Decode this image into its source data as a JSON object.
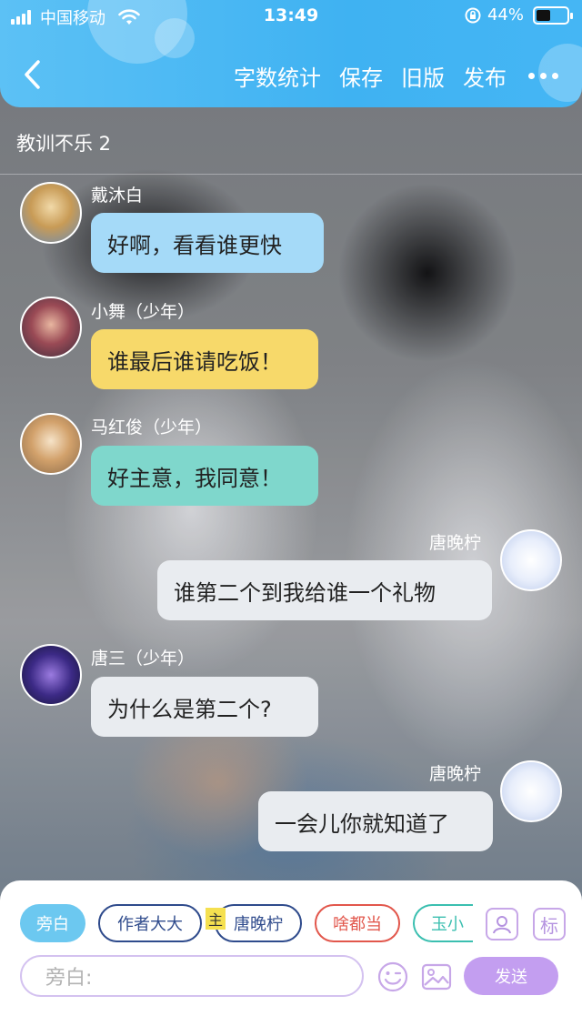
{
  "status_bar": {
    "carrier": "中国移动",
    "time": "13:49",
    "battery_percent": "44%"
  },
  "nav": {
    "actions": [
      "字数统计",
      "保存",
      "旧版",
      "发布"
    ]
  },
  "chat_title": "教训不乐 2",
  "messages": [
    {
      "speaker": "戴沐白",
      "text": "好啊，看看谁更快",
      "side": "left",
      "bubble_color": "#a5daf8"
    },
    {
      "speaker": "小舞（少年）",
      "text": "谁最后谁请吃饭！",
      "side": "left",
      "bubble_color": "#f7d96a"
    },
    {
      "speaker": "马红俊（少年）",
      "text": "好主意，我同意！",
      "side": "left",
      "bubble_color": "#7fd7cc"
    },
    {
      "speaker": "唐晚柠",
      "text": "谁第二个到我给谁一个礼物",
      "side": "right",
      "bubble_color": "#e9ecf0"
    },
    {
      "speaker": "唐三（少年）",
      "text": "为什么是第二个?",
      "side": "left",
      "bubble_color": "#e9ecf0"
    },
    {
      "speaker": "唐晚柠",
      "text": "一会儿你就知道了",
      "side": "right",
      "bubble_color": "#e9ecf0"
    }
  ],
  "chips": [
    {
      "label": "旁白",
      "style": "filled",
      "color": "#6cc8f0"
    },
    {
      "label": "作者大大",
      "style": "outline",
      "color": "#2f4b8c"
    },
    {
      "label": "唐晚柠",
      "style": "outline",
      "color": "#2f4b8c",
      "tag": "主"
    },
    {
      "label": "啥都当",
      "style": "outline",
      "color": "#e2574c"
    },
    {
      "label": "玉小",
      "style": "outline",
      "color": "#3bbfb0"
    }
  ],
  "tool_buttons": {
    "mark_label": "标"
  },
  "input": {
    "placeholder": "旁白:"
  },
  "send_label": "发送",
  "colors": {
    "accent": "#45b6f4",
    "send": "#c39ef0"
  }
}
